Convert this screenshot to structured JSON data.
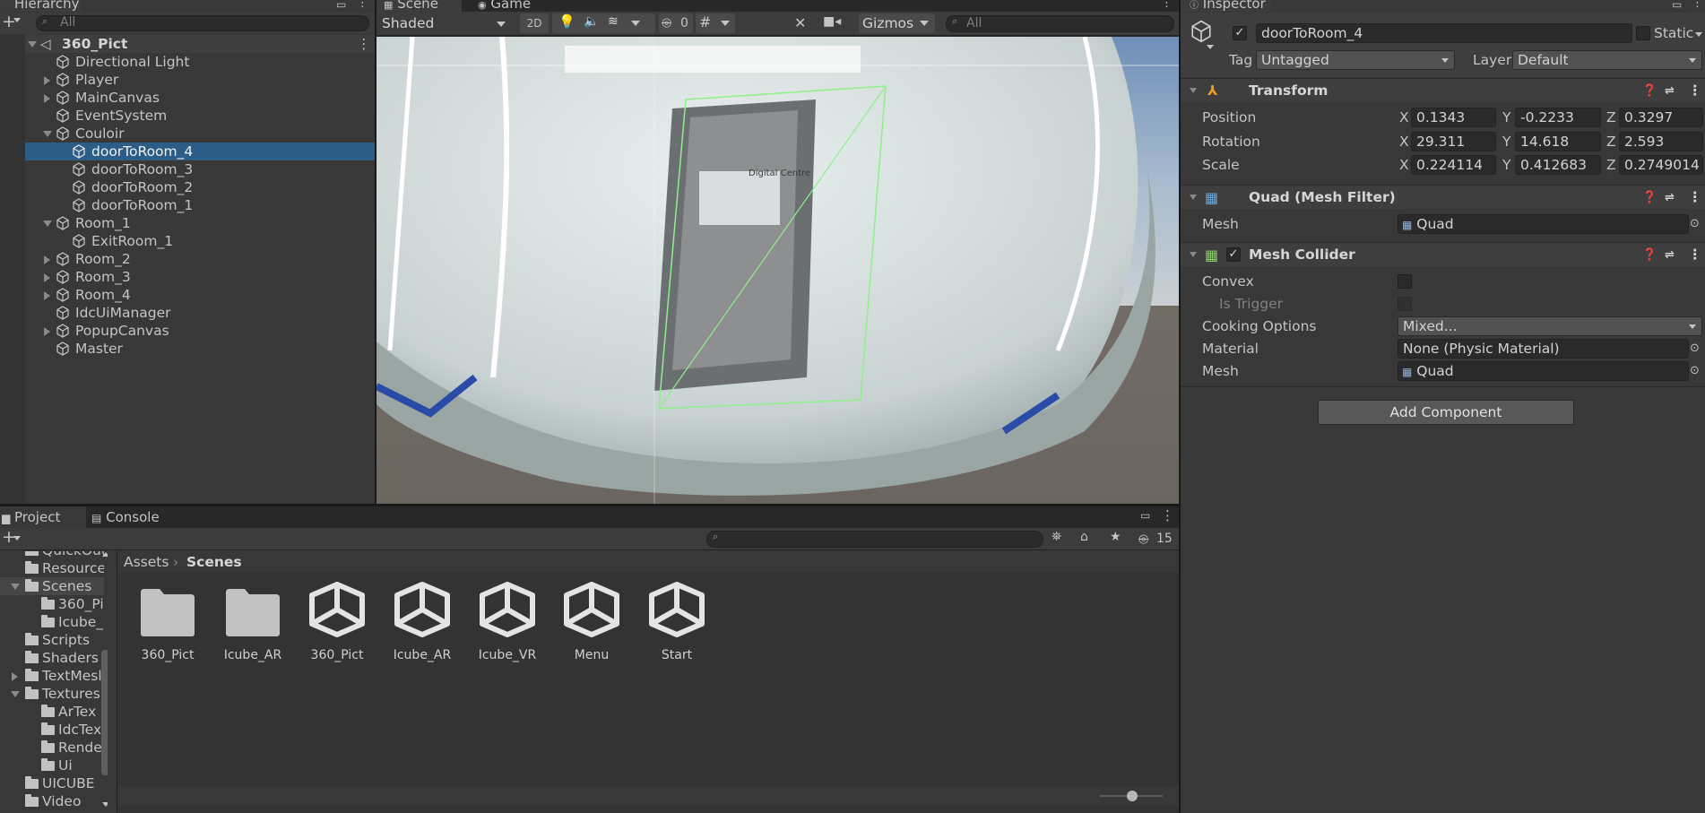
{
  "hierarchy": {
    "tab_label": "Hierarchy",
    "search_placeholder": "All",
    "scene_name": "360_Pict",
    "items": [
      {
        "label": "Directional Light"
      },
      {
        "label": "Player"
      },
      {
        "label": "MainCanvas"
      },
      {
        "label": "EventSystem"
      },
      {
        "label": "Couloir"
      },
      {
        "label": "doorToRoom_4"
      },
      {
        "label": "doorToRoom_3"
      },
      {
        "label": "doorToRoom_2"
      },
      {
        "label": "doorToRoom_1"
      },
      {
        "label": "Room_1"
      },
      {
        "label": "ExitRoom_1"
      },
      {
        "label": "Room_2"
      },
      {
        "label": "Room_3"
      },
      {
        "label": "Room_4"
      },
      {
        "label": "IdcUiManager"
      },
      {
        "label": "PopupCanvas"
      },
      {
        "label": "Master"
      }
    ]
  },
  "scene": {
    "tabs": [
      {
        "label": "Scene"
      },
      {
        "label": "Game"
      }
    ],
    "shading_mode": "Shaded",
    "mode_2d": "2D",
    "hidden_count": "0",
    "gizmos_label": "Gizmos",
    "search_placeholder": "All",
    "texture_text": "Digital Centre"
  },
  "inspector": {
    "tab_label": "Inspector",
    "object_name": "doorToRoom_4",
    "static_label": "Static",
    "tag_label": "Tag",
    "tag_value": "Untagged",
    "layer_label": "Layer",
    "layer_value": "Default",
    "transform": {
      "title": "Transform",
      "position_label": "Position",
      "rotation_label": "Rotation",
      "scale_label": "Scale",
      "axis_x": "X",
      "axis_y": "Y",
      "axis_z": "Z",
      "position": {
        "x": "0.1343",
        "y": "-0.2233",
        "z": "0.3297"
      },
      "rotation": {
        "x": "29.311",
        "y": "14.618",
        "z": "2.593"
      },
      "scale": {
        "x": "0.224114",
        "y": "0.412683",
        "z": "0.2749014"
      }
    },
    "mesh_filter": {
      "title": "Quad (Mesh Filter)",
      "mesh_label": "Mesh",
      "mesh_value": "Quad"
    },
    "mesh_collider": {
      "title": "Mesh Collider",
      "convex_label": "Convex",
      "is_trigger_label": "Is Trigger",
      "cooking_label": "Cooking Options",
      "cooking_value": "Mixed...",
      "material_label": "Material",
      "material_value": "None (Physic Material)",
      "mesh_label": "Mesh",
      "mesh_value": "Quad"
    },
    "add_component_label": "Add Component"
  },
  "project": {
    "tabs": [
      {
        "label": "Project"
      },
      {
        "label": "Console"
      }
    ],
    "hidden_count": "15",
    "breadcrumb": {
      "root": "Assets",
      "current": "Scenes"
    },
    "tree": [
      {
        "label": "QuickOut"
      },
      {
        "label": "Resource"
      },
      {
        "label": "Scenes"
      },
      {
        "label": "360_Pi"
      },
      {
        "label": "Icube_"
      },
      {
        "label": "Scripts"
      },
      {
        "label": "Shaders"
      },
      {
        "label": "TextMesl"
      },
      {
        "label": "Textures"
      },
      {
        "label": "ArTex"
      },
      {
        "label": "IdcTex"
      },
      {
        "label": "Render"
      },
      {
        "label": "Ui"
      },
      {
        "label": "UICUBE"
      },
      {
        "label": "Video"
      }
    ],
    "assets": [
      {
        "label": "360_Pict",
        "icon": "folder-icon"
      },
      {
        "label": "Icube_AR",
        "icon": "folder-icon"
      },
      {
        "label": "360_Pict",
        "icon": "unity-scene-icon"
      },
      {
        "label": "Icube_AR",
        "icon": "unity-scene-icon"
      },
      {
        "label": "Icube_VR",
        "icon": "unity-scene-icon"
      },
      {
        "label": "Menu",
        "icon": "unity-scene-icon"
      },
      {
        "label": "Start",
        "icon": "unity-scene-icon"
      }
    ]
  },
  "colors": {
    "selection": "#2c5d87",
    "panel": "#383838",
    "field": "#2a2a2a",
    "accent": "#3d87c9"
  }
}
